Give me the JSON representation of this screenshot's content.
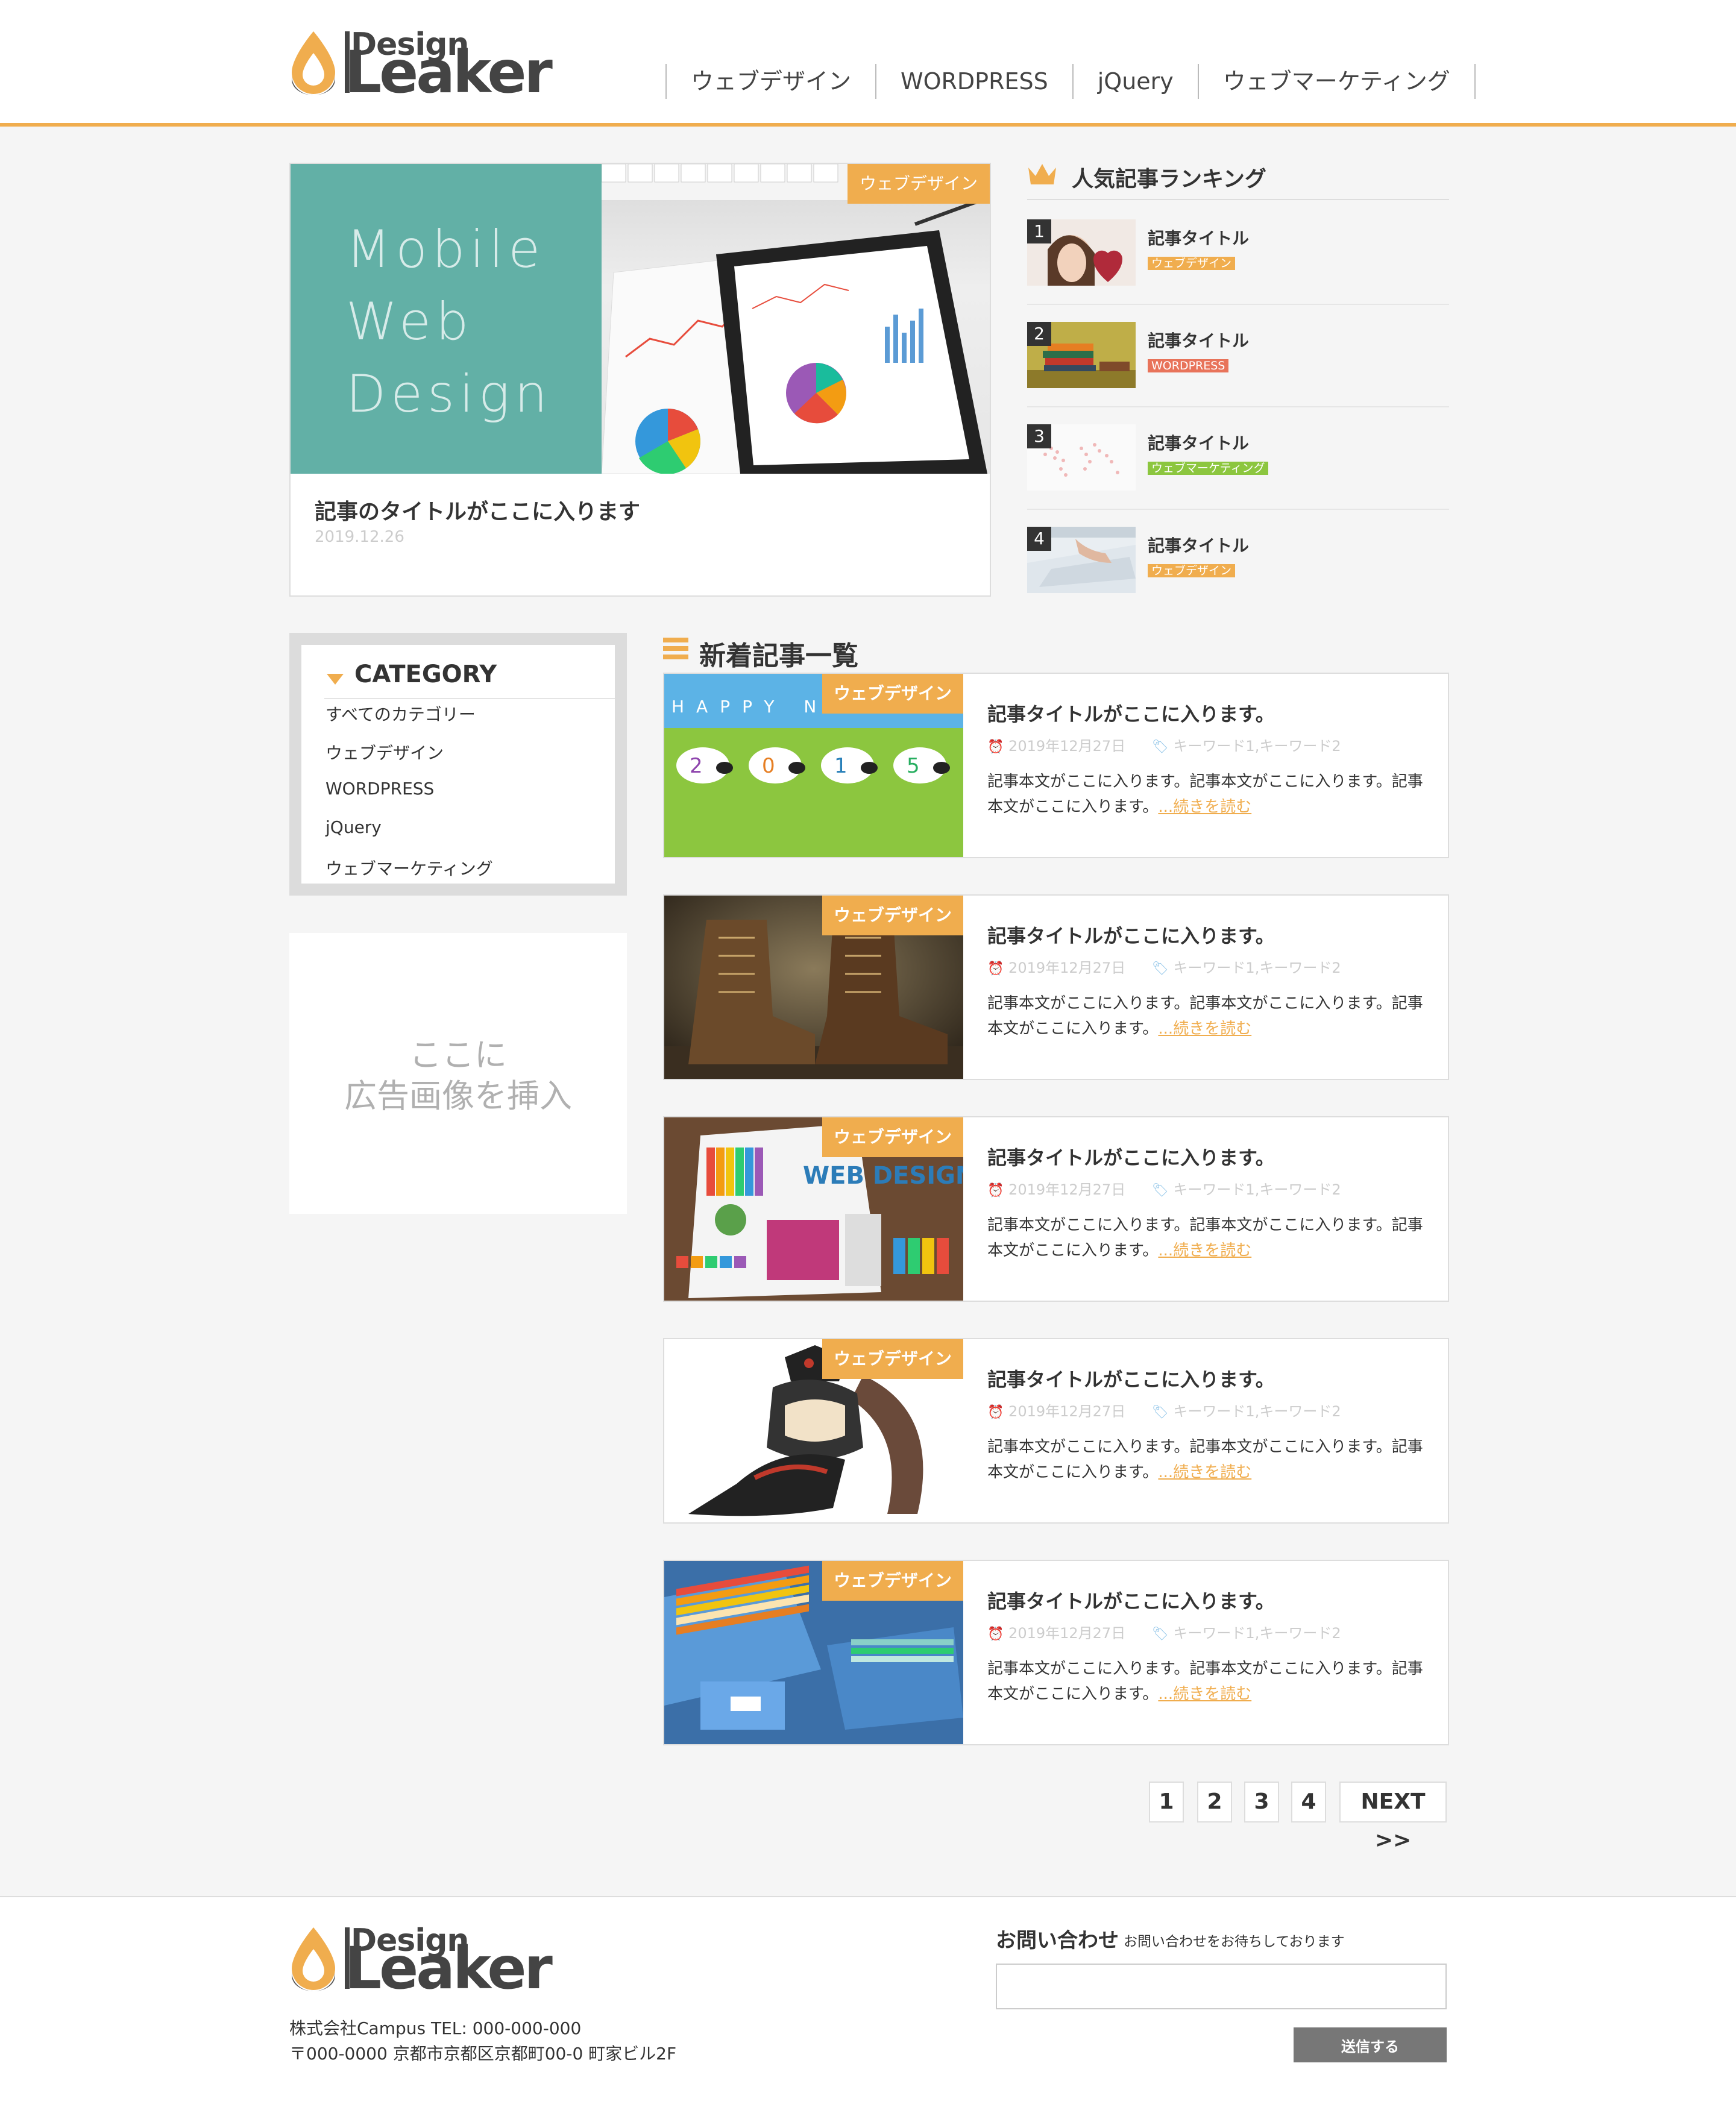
{
  "brand": {
    "logo_text_top": "Design",
    "logo_text_main": "Leaker",
    "accent_color": "#f0ad4e",
    "teal_color": "#62b0a6"
  },
  "nav": {
    "items": [
      {
        "label": "ウェブデザイン"
      },
      {
        "label": "WORDPRESS"
      },
      {
        "label": "jQuery"
      },
      {
        "label": "ウェブマーケティング"
      }
    ]
  },
  "hero": {
    "badge": "ウェブデザイン",
    "image_text": [
      "Mobile",
      "Web",
      "Design"
    ],
    "title": "記事のタイトルがここに入ります",
    "date": "2019.12.26"
  },
  "ranking": {
    "title": "人気記事ランキング",
    "icon": "crown-icon",
    "items": [
      {
        "num": "1",
        "title": "記事タイトル",
        "tag": "ウェブデザイン",
        "tag_color": "#f0ad4e"
      },
      {
        "num": "2",
        "title": "記事タイトル",
        "tag": "WORDPRESS",
        "tag_color": "#e8735a"
      },
      {
        "num": "3",
        "title": "記事タイトル",
        "tag": "ウェブマーケティング",
        "tag_color": "#8cc63f"
      },
      {
        "num": "4",
        "title": "記事タイトル",
        "tag": "ウェブデザイン",
        "tag_color": "#f0ad4e"
      }
    ]
  },
  "category": {
    "title": "CATEGORY",
    "items": [
      {
        "label": "すべてのカテゴリー"
      },
      {
        "label": "ウェブデザイン"
      },
      {
        "label": "WORDPRESS"
      },
      {
        "label": "jQuery"
      },
      {
        "label": "ウェブマーケティング"
      }
    ]
  },
  "ad": {
    "line1": "ここに",
    "line2": "広告画像を挿入"
  },
  "articles": {
    "title": "新着記事一覧",
    "items": [
      {
        "badge": "ウェブデザイン",
        "image_text": "HAPPY NE",
        "title": "記事タイトルがここに入ります。",
        "date": "2019年12月27日",
        "keywords": "キーワード1,キーワード2",
        "body": "記事本文がここに入ります。記事本文がここに入ります。記事本文がここに入ります。",
        "more": "...続きを読む"
      },
      {
        "badge": "ウェブデザイン",
        "title": "記事タイトルがここに入ります。",
        "date": "2019年12月27日",
        "keywords": "キーワード1,キーワード2",
        "body": "記事本文がここに入ります。記事本文がここに入ります。記事本文がここに入ります。",
        "more": "...続きを読む"
      },
      {
        "badge": "ウェブデザイン",
        "image_text": "WEB DESIGN",
        "title": "記事タイトルがここに入ります。",
        "date": "2019年12月27日",
        "keywords": "キーワード1,キーワード2",
        "body": "記事本文がここに入ります。記事本文がここに入ります。記事本文がここに入ります。",
        "more": "...続きを読む"
      },
      {
        "badge": "ウェブデザイン",
        "title": "記事タイトルがここに入ります。",
        "date": "2019年12月27日",
        "keywords": "キーワード1,キーワード2",
        "body": "記事本文がここに入ります。記事本文がここに入ります。記事本文がここに入ります。",
        "more": "...続きを読む"
      },
      {
        "badge": "ウェブデザイン",
        "title": "記事タイトルがここに入ります。",
        "date": "2019年12月27日",
        "keywords": "キーワード1,キーワード2",
        "body": "記事本文がここに入ります。記事本文がここに入ります。記事本文がここに入ります。",
        "more": "...続きを読む"
      }
    ]
  },
  "pagination": {
    "pages": [
      "1",
      "2",
      "3",
      "4"
    ],
    "next": "NEXT >>"
  },
  "footer": {
    "address_line1": "株式会社Campus TEL: 000-000-000",
    "address_line2": "〒000-0000 京都市京都区京都町00-0 町家ビル2F",
    "contact_title": "お問い合わせ",
    "contact_sub": "お問い合わせをお待ちしております",
    "contact_value": "",
    "send_label": "送信する"
  }
}
